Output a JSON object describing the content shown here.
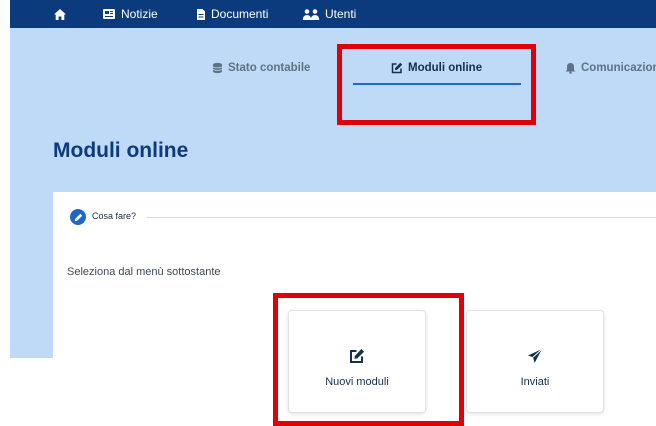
{
  "colors": {
    "brand": "#0c3b7d",
    "hero_background": "#bfdaf7",
    "accent": "#1f66c8",
    "highlight": "#e0000a"
  },
  "top_nav": {
    "home_icon": "home-icon",
    "items": [
      {
        "label": "Notizie",
        "icon": "newspaper-icon"
      },
      {
        "label": "Documenti",
        "icon": "document-icon"
      },
      {
        "label": "Utenti",
        "icon": "users-icon"
      }
    ]
  },
  "tabs": [
    {
      "label": "Stato contabile",
      "icon": "coins-icon",
      "active": false
    },
    {
      "label": "Moduli online",
      "icon": "edit-icon",
      "active": true
    },
    {
      "label": "Comunicazioni",
      "icon": "bell-icon",
      "active": false
    }
  ],
  "page_title": "Moduli online",
  "howto": {
    "icon": "pencil-icon",
    "label": "Cosa fare?"
  },
  "instruction": "Seleziona dal menù sottostante",
  "tiles": [
    {
      "label": "Nuovi moduli",
      "icon": "edit-icon"
    },
    {
      "label": "Inviati",
      "icon": "paper-plane-icon"
    }
  ]
}
